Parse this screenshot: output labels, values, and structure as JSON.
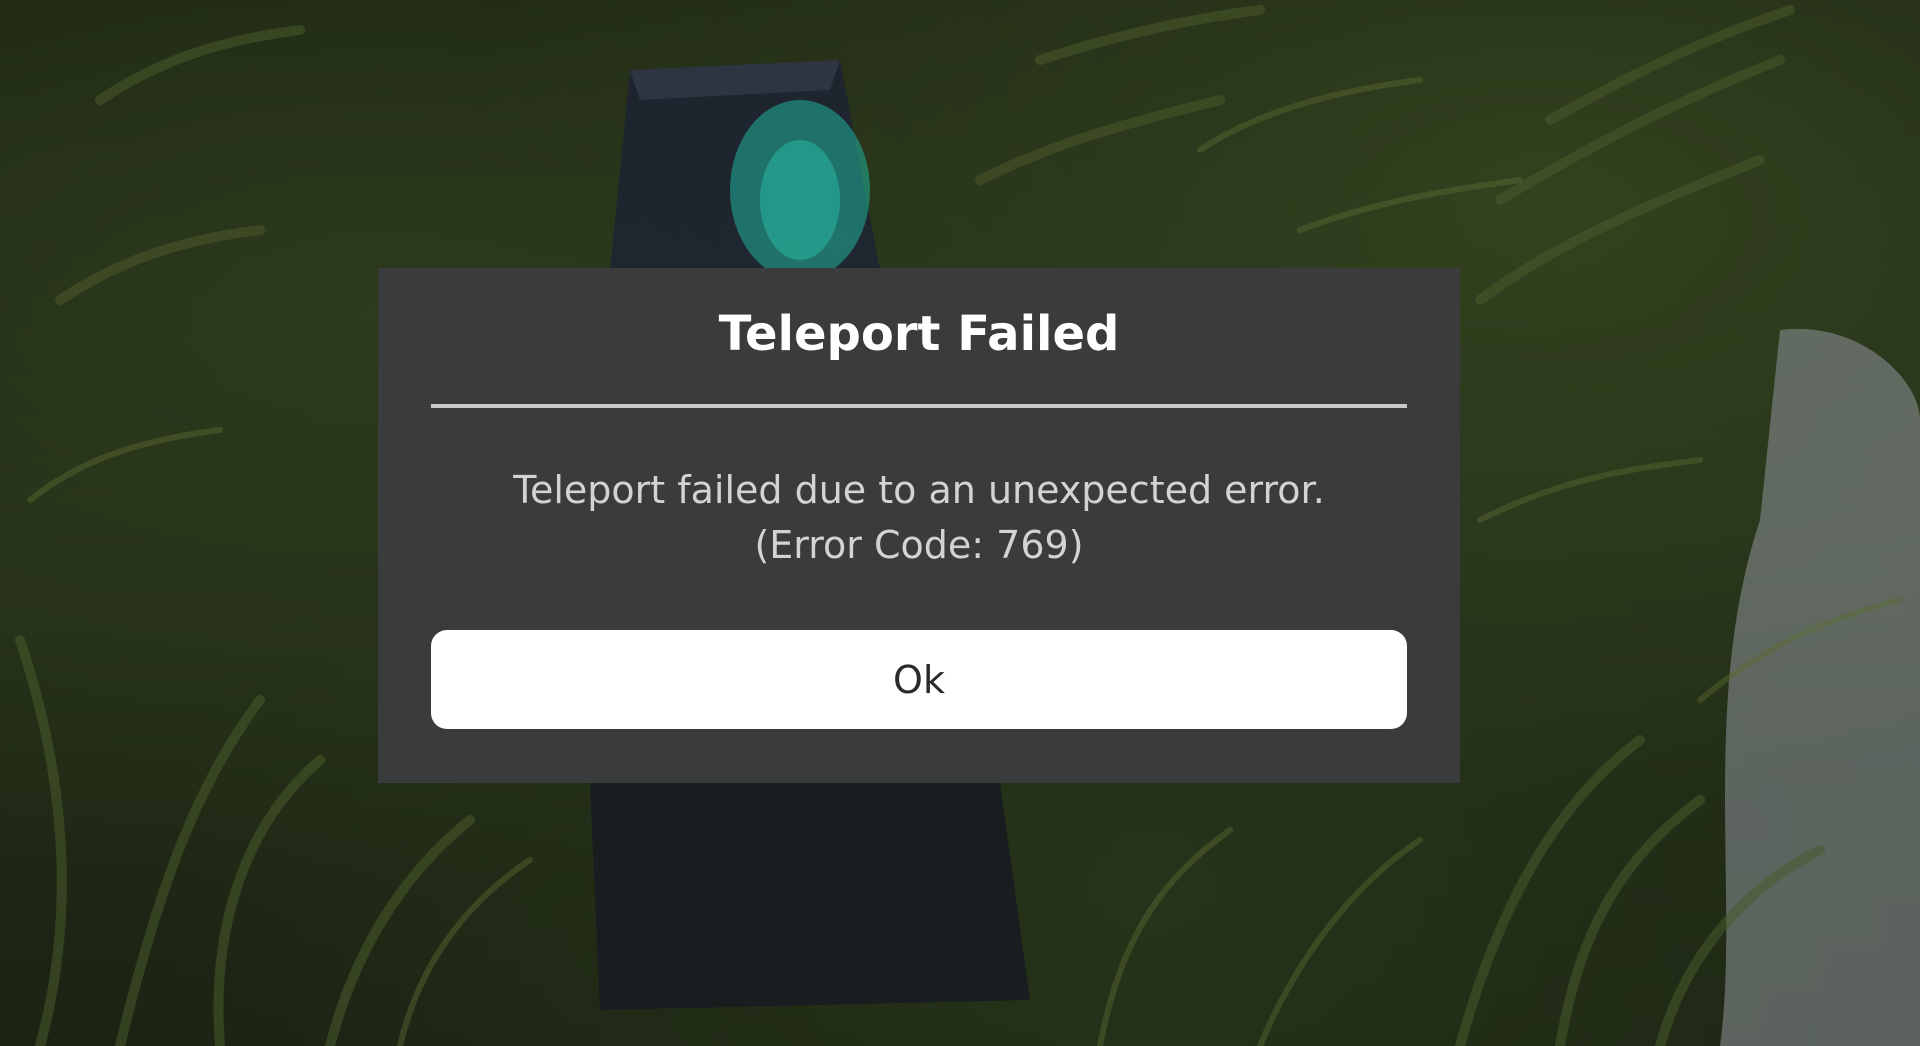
{
  "dialog": {
    "title": "Teleport Failed",
    "message_line1": "Teleport failed due to an unexpected error.",
    "message_line2": "(Error Code: 769)",
    "ok_label": "Ok"
  },
  "colors": {
    "dialog_background": "#3a3b3d",
    "title_text": "#ffffff",
    "message_text": "#d2d3d4",
    "divider": "#c7c8c9",
    "button_background": "#ffffff",
    "button_text": "#2a2a2a"
  }
}
